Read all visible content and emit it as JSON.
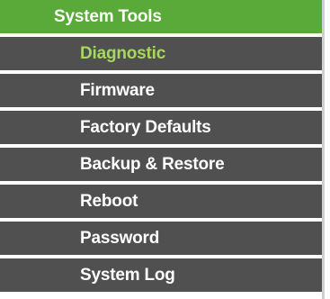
{
  "menu": {
    "title": "System Tools",
    "items": [
      {
        "label": "Diagnostic",
        "active": true
      },
      {
        "label": "Firmware",
        "active": false
      },
      {
        "label": "Factory Defaults",
        "active": false
      },
      {
        "label": "Backup & Restore",
        "active": false
      },
      {
        "label": "Reboot",
        "active": false
      },
      {
        "label": "Password",
        "active": false
      },
      {
        "label": "System Log",
        "active": false
      }
    ],
    "colors": {
      "header_bg": "#5aaa3a",
      "item_bg": "#505050",
      "item_text": "#ffffff",
      "active_text": "#a6d85c"
    }
  }
}
